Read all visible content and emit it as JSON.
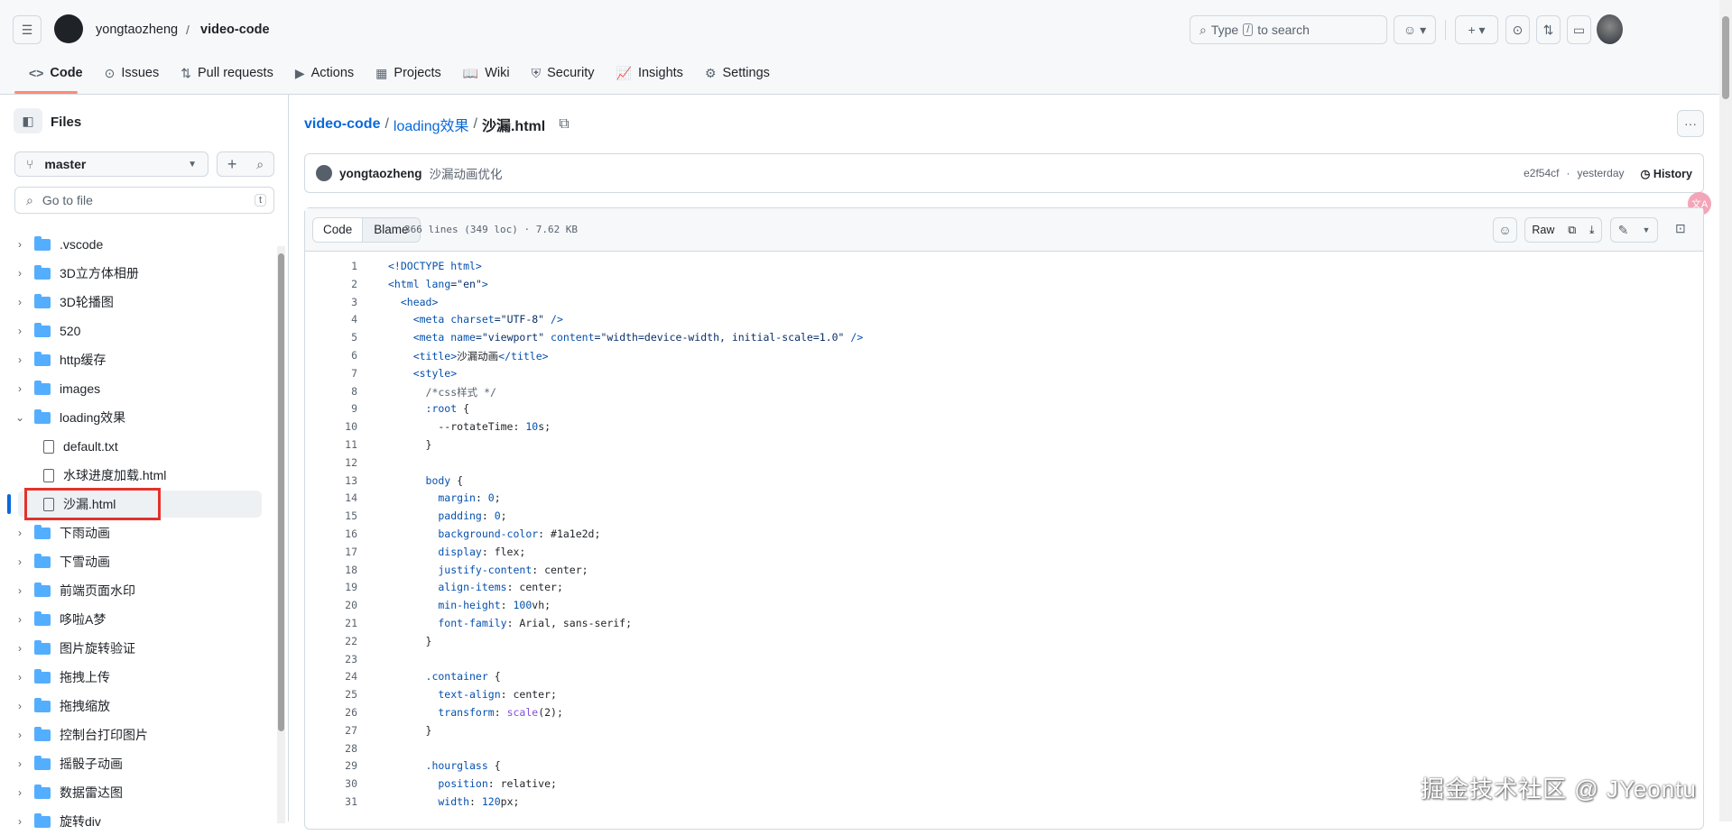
{
  "header": {
    "owner": "yongtaozheng",
    "repo": "video-code",
    "search_prefix": "Type",
    "search_key": "/",
    "search_suffix": "to search"
  },
  "tabs": [
    {
      "label": "Code",
      "icon": "<>"
    },
    {
      "label": "Issues",
      "icon": "⊙"
    },
    {
      "label": "Pull requests",
      "icon": "⇅"
    },
    {
      "label": "Actions",
      "icon": "▶"
    },
    {
      "label": "Projects",
      "icon": "▦"
    },
    {
      "label": "Wiki",
      "icon": "📖"
    },
    {
      "label": "Security",
      "icon": "⛨"
    },
    {
      "label": "Insights",
      "icon": "📈"
    },
    {
      "label": "Settings",
      "icon": "⚙"
    }
  ],
  "sidebar": {
    "title": "Files",
    "branch": "master",
    "go_to_file": "Go to file",
    "shortcut": "t",
    "items": [
      {
        "label": ".vscode",
        "type": "folder"
      },
      {
        "label": "3D立方体相册",
        "type": "folder"
      },
      {
        "label": "3D轮播图",
        "type": "folder"
      },
      {
        "label": "520",
        "type": "folder"
      },
      {
        "label": "http缓存",
        "type": "folder"
      },
      {
        "label": "images",
        "type": "folder"
      },
      {
        "label": "loading效果",
        "type": "folder-open"
      },
      {
        "label": "default.txt",
        "type": "file"
      },
      {
        "label": "水球进度加载.html",
        "type": "file"
      },
      {
        "label": "沙漏.html",
        "type": "file",
        "selected": true
      },
      {
        "label": "下雨动画",
        "type": "folder"
      },
      {
        "label": "下雪动画",
        "type": "folder"
      },
      {
        "label": "前端页面水印",
        "type": "folder"
      },
      {
        "label": "哆啦A梦",
        "type": "folder"
      },
      {
        "label": "图片旋转验证",
        "type": "folder"
      },
      {
        "label": "拖拽上传",
        "type": "folder"
      },
      {
        "label": "拖拽缩放",
        "type": "folder"
      },
      {
        "label": "控制台打印图片",
        "type": "folder"
      },
      {
        "label": "摇骰子动画",
        "type": "folder"
      },
      {
        "label": "数据雷达图",
        "type": "folder"
      },
      {
        "label": "旋转div",
        "type": "folder"
      }
    ]
  },
  "breadcrumb": {
    "repo": "video-code",
    "folder": "loading效果",
    "file": "沙漏.html"
  },
  "commit": {
    "author": "yongtaozheng",
    "message": "沙漏动画优化",
    "sha": "e2f54cf",
    "time": "yesterday",
    "history": "History"
  },
  "toolbar": {
    "code": "Code",
    "blame": "Blame",
    "info": "366 lines (349 loc) · 7.62 KB",
    "raw": "Raw"
  },
  "code_lines": [
    [
      [
        "<!DOCTYPE html>",
        "t"
      ]
    ],
    [
      [
        "<html ",
        "t"
      ],
      [
        "lang",
        "n"
      ],
      [
        "=\"en\"",
        "s"
      ],
      [
        ">",
        "t"
      ]
    ],
    [
      [
        "  <head>",
        "t"
      ]
    ],
    [
      [
        "    <meta ",
        "t"
      ],
      [
        "charset",
        "n"
      ],
      [
        "=\"UTF-8\"",
        "s"
      ],
      [
        " />",
        "t"
      ]
    ],
    [
      [
        "    <meta ",
        "t"
      ],
      [
        "name",
        "n"
      ],
      [
        "=\"viewport\" ",
        "s"
      ],
      [
        "content",
        "n"
      ],
      [
        "=\"width=device-width, initial-scale=1.0\"",
        "s"
      ],
      [
        " />",
        "t"
      ]
    ],
    [
      [
        "    <title>",
        "t"
      ],
      [
        "沙漏动画",
        "v"
      ],
      [
        "</title>",
        "t"
      ]
    ],
    [
      [
        "    <style>",
        "t"
      ]
    ],
    [
      [
        "      /*css样式 */",
        "c"
      ]
    ],
    [
      [
        "      :root",
        "p"
      ],
      [
        " {",
        "v"
      ]
    ],
    [
      [
        "        --rotateTime: ",
        "v"
      ],
      [
        "10",
        "n"
      ],
      [
        "s;",
        "v"
      ]
    ],
    [
      [
        "      }",
        "v"
      ]
    ],
    [
      [
        "",
        "v"
      ]
    ],
    [
      [
        "      body",
        "p"
      ],
      [
        " {",
        "v"
      ]
    ],
    [
      [
        "        margin",
        "p"
      ],
      [
        ": ",
        "v"
      ],
      [
        "0",
        "n"
      ],
      [
        ";",
        "v"
      ]
    ],
    [
      [
        "        padding",
        "p"
      ],
      [
        ": ",
        "v"
      ],
      [
        "0",
        "n"
      ],
      [
        ";",
        "v"
      ]
    ],
    [
      [
        "        background-color",
        "p"
      ],
      [
        ": #1a1e2d;",
        "v"
      ]
    ],
    [
      [
        "        display",
        "p"
      ],
      [
        ": flex;",
        "v"
      ]
    ],
    [
      [
        "        justify-content",
        "p"
      ],
      [
        ": center;",
        "v"
      ]
    ],
    [
      [
        "        align-items",
        "p"
      ],
      [
        ": center;",
        "v"
      ]
    ],
    [
      [
        "        min-height",
        "p"
      ],
      [
        ": ",
        "v"
      ],
      [
        "100",
        "n"
      ],
      [
        "vh;",
        "v"
      ]
    ],
    [
      [
        "        font-family",
        "p"
      ],
      [
        ": Arial, sans-serif;",
        "v"
      ]
    ],
    [
      [
        "      }",
        "v"
      ]
    ],
    [
      [
        "",
        "v"
      ]
    ],
    [
      [
        "      .container",
        "p"
      ],
      [
        " {",
        "v"
      ]
    ],
    [
      [
        "        text-align",
        "p"
      ],
      [
        ": center;",
        "v"
      ]
    ],
    [
      [
        "        transform",
        "p"
      ],
      [
        ": ",
        "v"
      ],
      [
        "scale",
        "f"
      ],
      [
        "(2);",
        "v"
      ]
    ],
    [
      [
        "      }",
        "v"
      ]
    ],
    [
      [
        "",
        "v"
      ]
    ],
    [
      [
        "      .hourglass",
        "p"
      ],
      [
        " {",
        "v"
      ]
    ],
    [
      [
        "        position",
        "p"
      ],
      [
        ": relative;",
        "v"
      ]
    ],
    [
      [
        "        width",
        "p"
      ],
      [
        ": ",
        "v"
      ],
      [
        "120",
        "n"
      ],
      [
        "px;",
        "v"
      ]
    ]
  ],
  "watermark": "掘金技术社区 @ JYeontu",
  "colors": {
    "accent": "#0969da",
    "tab_underline": "#fd8c73",
    "folder": "#54aeff",
    "highlight": "#e5312b"
  }
}
